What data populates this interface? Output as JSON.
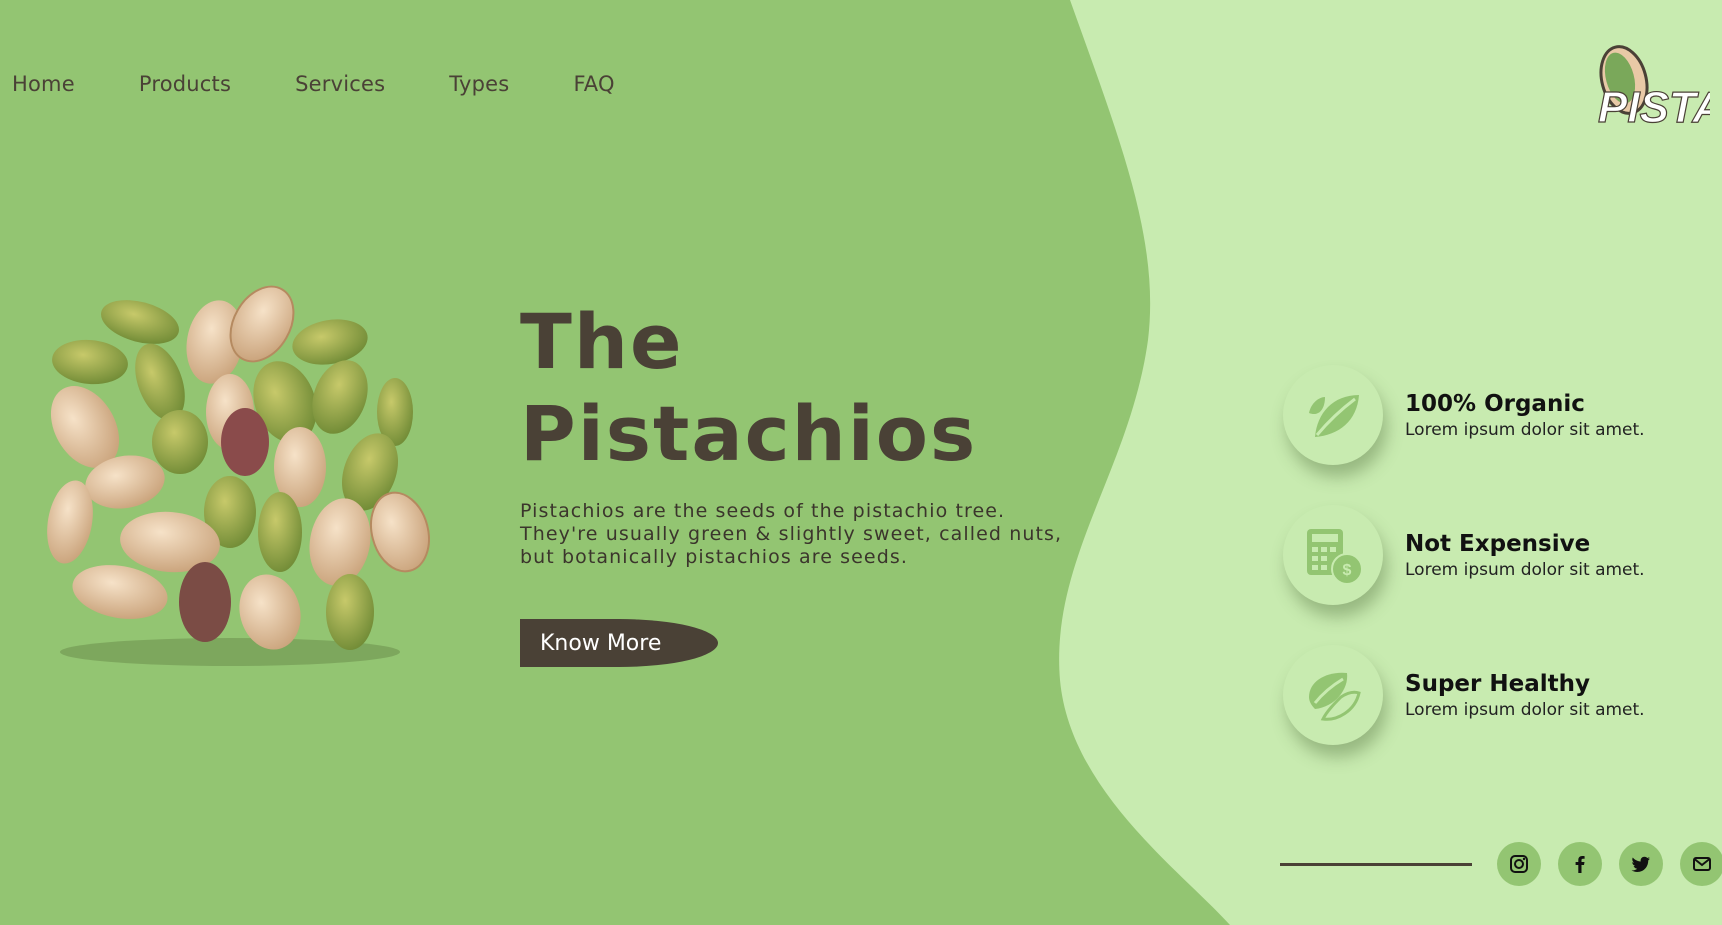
{
  "nav": {
    "items": [
      {
        "label": "Home"
      },
      {
        "label": "Products"
      },
      {
        "label": "Services"
      },
      {
        "label": "Types"
      },
      {
        "label": "FAQ"
      }
    ]
  },
  "logo": {
    "text": "PISTA",
    "icon": "pistachio-logo-icon"
  },
  "hero": {
    "title_line1": "The",
    "title_line2": "Pistachios",
    "description": "Pistachios are the seeds of the pistachio tree. They're usually green & slightly sweet, called nuts, but botanically pistachios are seeds.",
    "cta_label": "Know More"
  },
  "features": [
    {
      "icon": "leaf-icon",
      "title": "100% Organic",
      "subtitle": "Lorem ipsum dolor sit amet."
    },
    {
      "icon": "calculator-money-icon",
      "title": "Not Expensive",
      "subtitle": "Lorem ipsum dolor sit amet."
    },
    {
      "icon": "pistachio-icon",
      "title": "Super Healthy",
      "subtitle": "Lorem ipsum dolor sit amet."
    }
  ],
  "social": [
    "instagram-icon",
    "facebook-icon",
    "twitter-icon",
    "mail-icon"
  ],
  "colors": {
    "primary_green": "#93c572",
    "light_green": "#c8ebb0",
    "dark_brown": "#4a4136"
  }
}
